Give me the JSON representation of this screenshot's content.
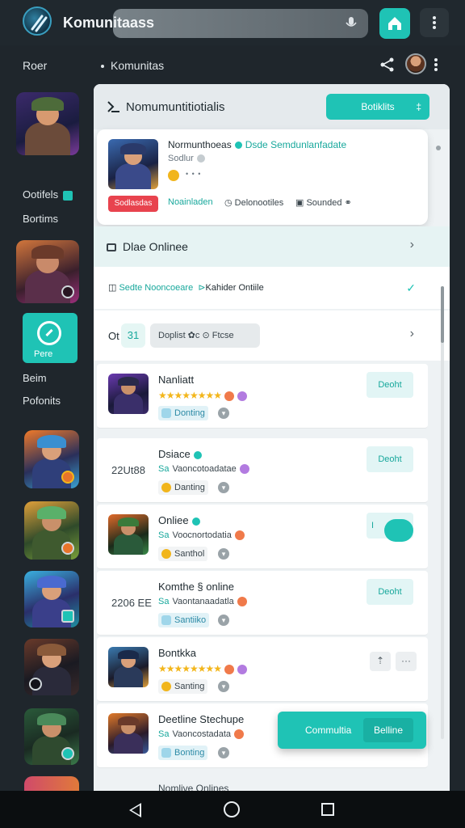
{
  "topbar": {
    "app_title": "Komunitaass",
    "logo_icon": "slash-logo-icon"
  },
  "subheader": {
    "left_label": "Roer",
    "title": "Komunitas"
  },
  "rail": {
    "label_1": "Ootifels",
    "label_2": "Bortims",
    "active_label": "Pere",
    "label_3": "Beim",
    "label_4": "Pofonits"
  },
  "panel": {
    "title": "Nomumuntitiotialis",
    "header_button": "Botiklits",
    "header_button_chev": "‡",
    "featured": {
      "name": "Normunthoeas",
      "tag": "Dsde Semdunlanfadate",
      "sub": "Sodlur",
      "dots": "• • •",
      "red_label": "Sodlasdas",
      "meta_1": "Noainladen",
      "meta_2": "Delonootiles",
      "meta_3": "Sounded"
    },
    "section_1": "Dlae Onlinee",
    "section_2_a": "Sedte Nooncoeare",
    "section_2_b": "Kahider Ontiile",
    "section_3": {
      "prefix": "Ot",
      "pill": "31",
      "box": "Doplist  ✿c  ⊙  Ftcse"
    },
    "games": [
      {
        "pre": "",
        "name": "Nanliatt",
        "line2": "★★★★★★★★",
        "line3": "Donting",
        "button": "Deoht",
        "style": "stars"
      },
      {
        "pre": "22Ut88",
        "name": "Dsiace",
        "line2_a": "Sa",
        "line2": "Vaoncotoadatae",
        "line3": "Danting",
        "button": "Deoht",
        "style": "text"
      },
      {
        "pre": "",
        "name": "Onliee",
        "line2_a": "Sa",
        "line2": "Voocnortodatia",
        "line3": "Santhol",
        "button": "I",
        "style": "text"
      },
      {
        "pre": "2206 EE",
        "name": "Komthe § online",
        "line2_a": "Sa",
        "line2": "Vaontanaadatla",
        "line3": "Santiiko",
        "button": "Deoht",
        "style": "text"
      },
      {
        "pre": "",
        "name": "Bontkka",
        "line2": "★★★★★★★★",
        "line3": "Santing",
        "button": "",
        "style": "stars"
      },
      {
        "pre": "",
        "name": "Deetline Stechupe",
        "line2_a": "Sa",
        "line2": "Vaoncostadata",
        "line3": "Bonting",
        "button": "",
        "style": "text"
      }
    ],
    "bottom_cta_left": "Commultia",
    "bottom_cta_right": "Belline",
    "peek_text": "Nomlive Onlines"
  },
  "colors": {
    "accent": "#1fc3b5",
    "danger": "#e8434e",
    "star": "#f3b61b",
    "dark_bg": "#1f262c"
  }
}
